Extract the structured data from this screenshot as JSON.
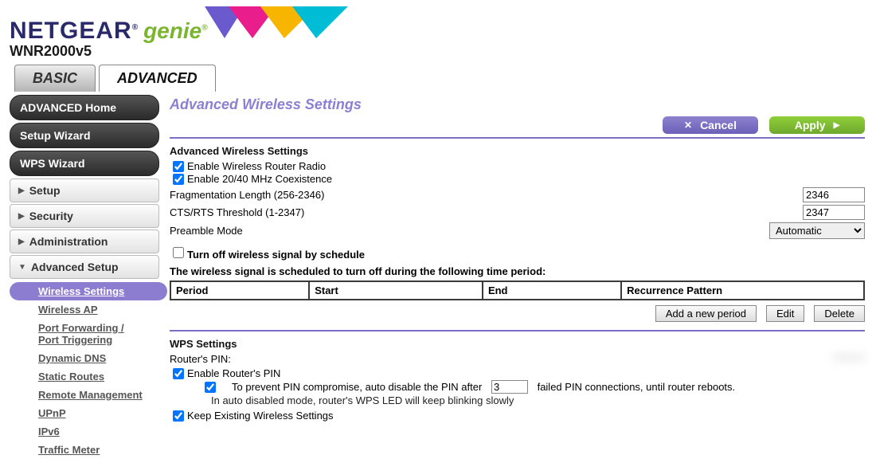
{
  "brand": {
    "name": "NETGEAR",
    "product": "genie",
    "model": "WNR2000v5"
  },
  "main_tabs": {
    "basic": "BASIC",
    "advanced": "ADVANCED"
  },
  "sidebar": {
    "adv_home": "ADVANCED Home",
    "setup_wizard": "Setup Wizard",
    "wps_wizard": "WPS Wizard",
    "groups": {
      "setup": "Setup",
      "security": "Security",
      "administration": "Administration",
      "advanced_setup": "Advanced Setup"
    },
    "adv_setup_items": {
      "wireless_settings": "Wireless Settings",
      "wireless_ap": "Wireless AP",
      "port_fwd": "Port Forwarding / Port Triggering",
      "ddns": "Dynamic DNS",
      "static_routes": "Static Routes",
      "remote_mgmt": "Remote Management",
      "upnp": "UPnP",
      "ipv6": "IPv6",
      "traffic_meter": "Traffic Meter"
    }
  },
  "page": {
    "title": "Advanced Wireless Settings",
    "buttons": {
      "cancel": "Cancel",
      "apply": "Apply"
    },
    "section1_head": "Advanced Wireless Settings",
    "enable_radio": "Enable Wireless Router Radio",
    "enable_coex": "Enable 20/40 MHz Coexistence",
    "frag_label": "Fragmentation Length (256-2346)",
    "frag_value": "2346",
    "cts_label": "CTS/RTS Threshold (1-2347)",
    "cts_value": "2347",
    "preamble_label": "Preamble Mode",
    "preamble_value": "Automatic",
    "sched_toggle": "Turn off wireless signal by schedule",
    "sched_note": "The wireless signal is scheduled to turn off during the following time period:",
    "sched_cols": {
      "period": "Period",
      "start": "Start",
      "end": "End",
      "recur": "Recurrence Pattern"
    },
    "sched_btns": {
      "add": "Add a new period",
      "edit": "Edit",
      "delete": "Delete"
    },
    "wps_head": "WPS Settings",
    "router_pin_label": "Router's PIN:",
    "router_pin_value": "********",
    "enable_pin": "Enable Router's PIN",
    "pin_compromise_prefix": "To prevent PIN compromise, auto disable the PIN after",
    "pin_fail_count": "3",
    "pin_compromise_suffix": "failed PIN connections, until router reboots.",
    "pin_led_note": "In auto disabled mode, router's WPS LED will keep blinking slowly",
    "keep_settings": "Keep Existing Wireless Settings"
  }
}
